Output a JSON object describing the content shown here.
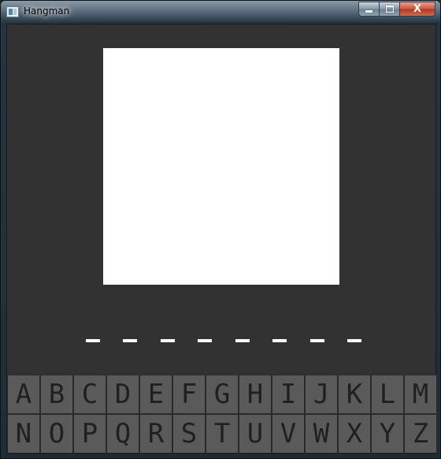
{
  "window": {
    "title": "Hangman",
    "close_glyph": "X"
  },
  "word": {
    "slots": [
      "_",
      "_",
      "_",
      "_",
      "_",
      "_",
      "_",
      "_"
    ]
  },
  "keyboard": {
    "rows": [
      [
        "A",
        "B",
        "C",
        "D",
        "E",
        "F",
        "G",
        "H",
        "I",
        "J",
        "K",
        "L",
        "M"
      ],
      [
        "N",
        "O",
        "P",
        "Q",
        "R",
        "S",
        "T",
        "U",
        "V",
        "W",
        "X",
        "Y",
        "Z"
      ]
    ]
  },
  "colors": {
    "background": "#323232",
    "drawing_canvas": "#ffffff",
    "key_background": "#5a5a5a",
    "key_text": "#202020"
  }
}
